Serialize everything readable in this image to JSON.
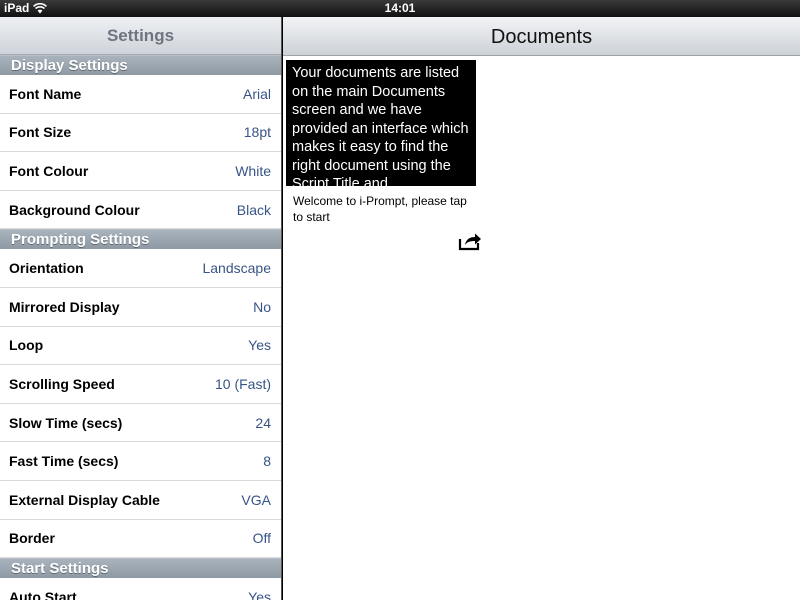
{
  "statusbar": {
    "carrier": "iPad",
    "time": "14:01"
  },
  "settings": {
    "title": "Settings",
    "sections": [
      {
        "header": "Display Settings",
        "rows": [
          {
            "label": "Font Name",
            "value": "Arial"
          },
          {
            "label": "Font Size",
            "value": "18pt"
          },
          {
            "label": "Font Colour",
            "value": "White"
          },
          {
            "label": "Background Colour",
            "value": "Black"
          }
        ]
      },
      {
        "header": "Prompting Settings",
        "rows": [
          {
            "label": "Orientation",
            "value": "Landscape"
          },
          {
            "label": "Mirrored Display",
            "value": "No"
          },
          {
            "label": "Loop",
            "value": "Yes"
          },
          {
            "label": "Scrolling Speed",
            "value": "10 (Fast)"
          },
          {
            "label": "Slow Time (secs)",
            "value": "24"
          },
          {
            "label": "Fast Time (secs)",
            "value": "8"
          },
          {
            "label": "External Display Cable",
            "value": "VGA"
          },
          {
            "label": "Border",
            "value": "Off"
          }
        ]
      },
      {
        "header": "Start Settings",
        "rows": [
          {
            "label": "Auto Start",
            "value": "Yes"
          }
        ]
      }
    ]
  },
  "documents": {
    "title": "Documents",
    "card": {
      "preview": "Your documents are listed on the main Documents screen and we have provided an interface which makes it easy to find the right document using the Script Title and",
      "caption": "Welcome to i-Prompt, please tap to start"
    }
  },
  "icons": {
    "wifi": "wifi-icon",
    "share": "share-icon"
  }
}
